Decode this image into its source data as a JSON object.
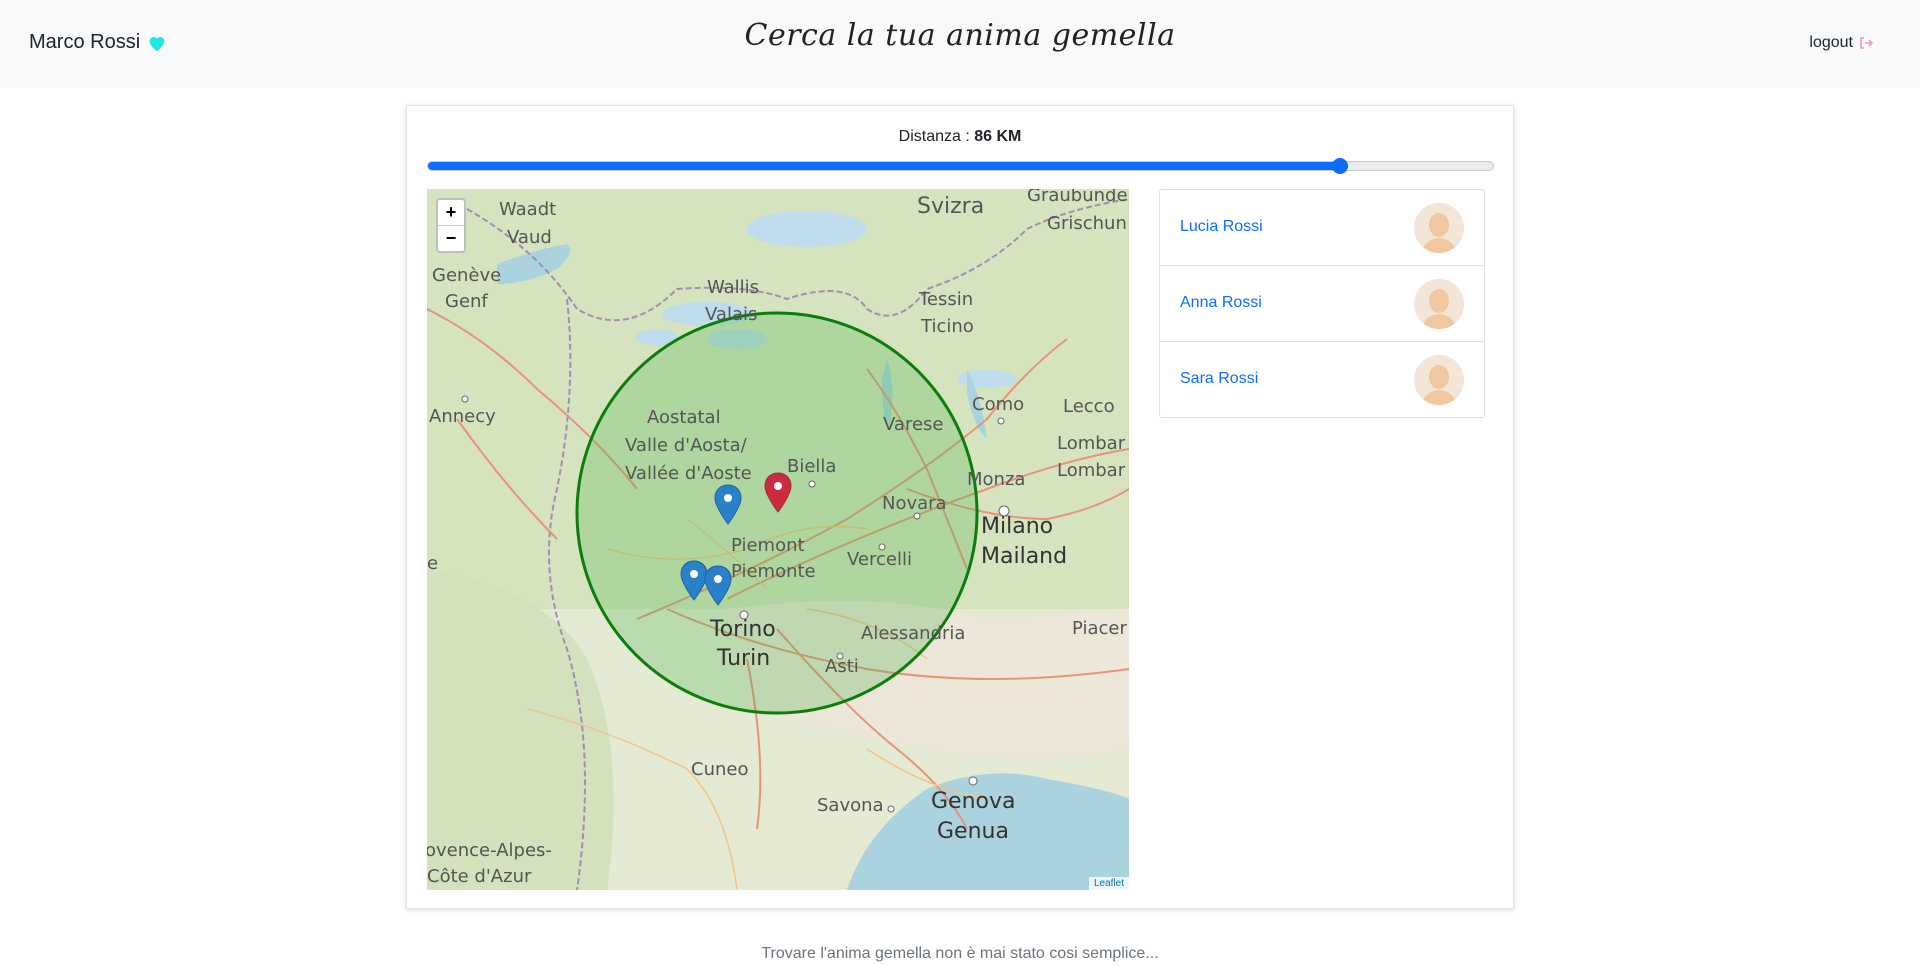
{
  "header": {
    "user_name": "Marco Rossi",
    "title": "Cerca la tua anima gemella",
    "logout_label": "logout",
    "heart_color": "#1fe5e5",
    "logout_icon_color": "#f29aa6"
  },
  "distance": {
    "label": "Distanza :",
    "value": "86 KM",
    "slider_fraction": 0.856
  },
  "map": {
    "zoom_in": "+",
    "zoom_out": "−",
    "attribution": "Leaflet",
    "labels": {
      "svizra": "Svizra",
      "graubunden": "Graubunde",
      "grischun": "Grischun",
      "waadt": "Waadt",
      "vaud": "Vaud",
      "geneve": "Genève",
      "genf": "Genf",
      "wallis": "Wallis",
      "valais": "Valais",
      "tessin": "Tessin",
      "ticino": "Ticino",
      "annecy": "Annecy",
      "como": "Como",
      "lecco": "Lecco",
      "lombardia1": "Lombar",
      "lombardia2": "Lombar",
      "aostatal": "Aostatal",
      "valledaosta": "Valle d'Aosta/",
      "valleedaoste": "Vallée d'Aoste",
      "biella": "Biella",
      "varese": "Varese",
      "monza": "Monza",
      "novara": "Novara",
      "milano": "Milano",
      "mailand": "Mailand",
      "piemont": "Piemont",
      "piemonte": "Piemonte",
      "vercelli": "Vercelli",
      "torino": "Torino",
      "turin": "Turin",
      "alessandria": "Alessandria",
      "asti": "Asti",
      "piacenza": "Piacer",
      "cuneo": "Cuneo",
      "savona": "Savona",
      "genova": "Genova",
      "genua": "Genua",
      "provence1": "ovence-Alpes-",
      "provence2": "Côte d'Azur",
      "e": "e"
    }
  },
  "matches": [
    {
      "name": "Lucia Rossi"
    },
    {
      "name": "Anna Rossi"
    },
    {
      "name": "Sara Rossi"
    }
  ],
  "footer": "Trovare l'anima gemella non è mai stato cosi semplice..."
}
